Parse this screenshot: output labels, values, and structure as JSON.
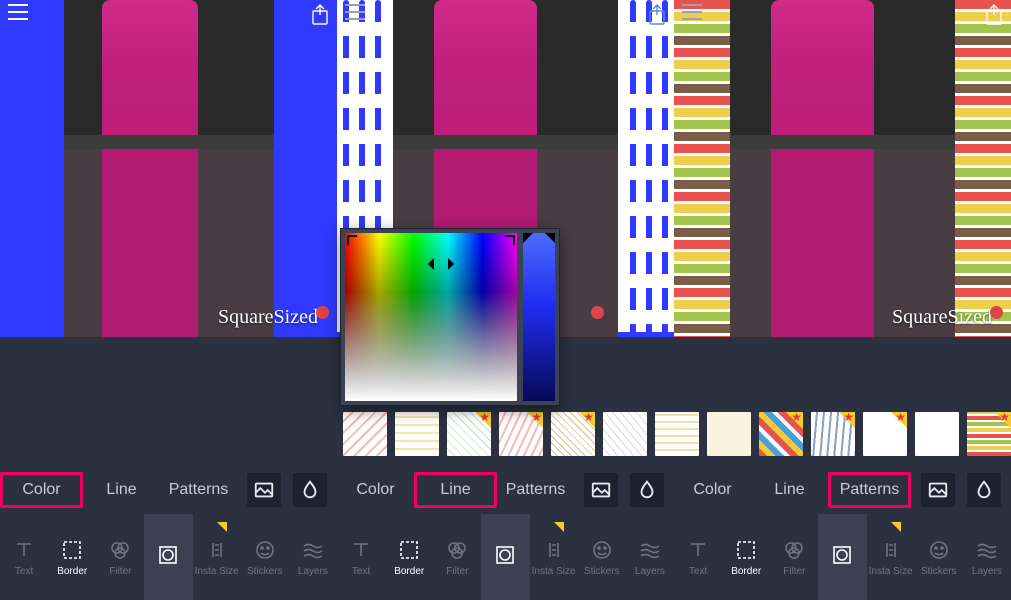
{
  "watermark": "SquareSized",
  "tabs": {
    "color": "Color",
    "line": "Line",
    "patterns": "Patterns"
  },
  "panel_highlight_tab": [
    "color",
    "line",
    "patterns"
  ],
  "toolbar": {
    "text": "Text",
    "border": "Border",
    "filter": "Filter",
    "crop": "",
    "instasize": "Insta Size",
    "stickers": "Stickers",
    "layers": "Layers"
  },
  "icons": {
    "hamburger": "menu-icon",
    "share": "share-icon",
    "gallery_chip": "image-gallery-icon",
    "drop_chip": "droplet-icon",
    "text": "text-tool-icon",
    "border": "border-tool-icon",
    "filter": "filter-tool-icon",
    "crop": "square-crop-icon",
    "instasize": "instasize-icon",
    "stickers": "stickers-icon",
    "layers": "layers-icon"
  },
  "colors": {
    "accent_blue": "#2f39ff",
    "highlight": "#f00065",
    "bg": "#2b3140"
  },
  "pattern_thumbs": [
    {
      "premium": false
    },
    {
      "premium": false
    },
    {
      "premium": true
    },
    {
      "premium": true
    },
    {
      "premium": true
    },
    {
      "premium": false
    },
    {
      "premium": false
    },
    {
      "premium": false
    },
    {
      "premium": true
    },
    {
      "premium": true
    },
    {
      "premium": true
    },
    {
      "premium": false
    },
    {
      "premium": true
    },
    {
      "premium": false
    }
  ]
}
